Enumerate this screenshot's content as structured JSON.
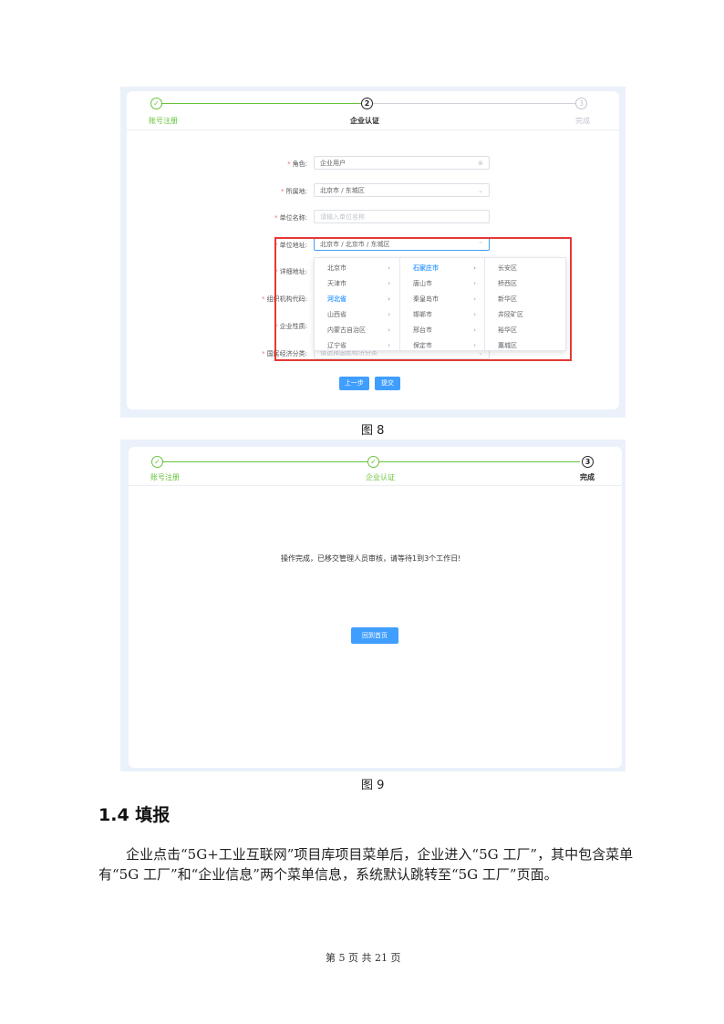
{
  "figure8": {
    "steps": [
      {
        "label": "账号注册",
        "status": "done",
        "num": "✓"
      },
      {
        "label": "企业认证",
        "status": "active",
        "num": "2"
      },
      {
        "label": "完成",
        "status": "pending",
        "num": "3"
      }
    ],
    "form": {
      "role": {
        "label": "角色:",
        "value": "企业用户"
      },
      "region": {
        "label": "所属地:",
        "value": "北京市 / 东城区"
      },
      "name": {
        "label": "单位名称:",
        "placeholder": "请输入单位名称"
      },
      "address": {
        "label": "单位地址:",
        "value": "北京市 / 北京市 / 东城区"
      },
      "detail": {
        "label": "详细地址:"
      },
      "org_code": {
        "label": "组织机构代码:"
      },
      "nature": {
        "label": "企业性质:"
      },
      "economy": {
        "label": "国民经济分类:",
        "placeholder": "请选择国民经济分类"
      }
    },
    "cascader": {
      "provinces": [
        "北京市",
        "天津市",
        "河北省",
        "山西省",
        "内蒙古自治区",
        "辽宁省"
      ],
      "selected_province": "河北省",
      "cities": [
        "石家庄市",
        "唐山市",
        "秦皇岛市",
        "邯郸市",
        "邢台市",
        "保定市"
      ],
      "selected_city": "石家庄市",
      "districts": [
        "长安区",
        "桥西区",
        "新华区",
        "井陉矿区",
        "裕华区",
        "藁城区"
      ]
    },
    "buttons": {
      "prev": "上一步",
      "submit": "提交"
    },
    "caption": "图 8"
  },
  "figure9": {
    "steps": [
      {
        "label": "账号注册",
        "status": "done",
        "num": "✓"
      },
      {
        "label": "企业认证",
        "status": "done",
        "num": "✓"
      },
      {
        "label": "完成",
        "status": "active",
        "num": "3"
      }
    ],
    "message": "操作完成，已移交管理人员审核，请等待1到3个工作日!",
    "home_button": "回到首页",
    "caption": "图 9"
  },
  "section": {
    "title": "1.4 填报",
    "paragraph": "企业点击“5G+工业互联网”项目库项目菜单后，企业进入“5G 工厂”，其中包含菜单有“5G 工厂”和“企业信息”两个菜单信息，系统默认跳转至“5G 工厂”页面。"
  },
  "footer": "第 5 页 共 21 页",
  "colors": {
    "primary": "#409eff",
    "success": "#67c23a",
    "highlight": "#e53935"
  }
}
